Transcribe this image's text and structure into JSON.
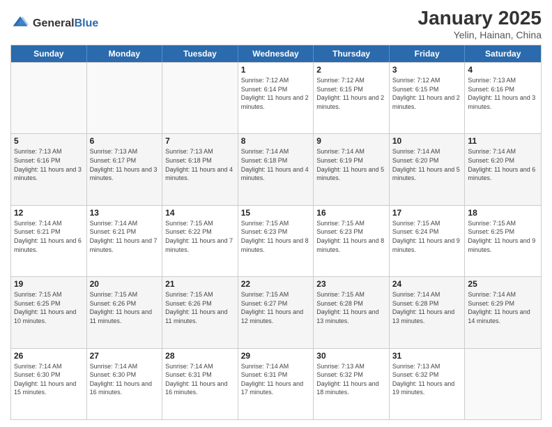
{
  "header": {
    "logo_general": "General",
    "logo_blue": "Blue",
    "title": "January 2025",
    "location": "Yelin, Hainan, China"
  },
  "weekdays": [
    "Sunday",
    "Monday",
    "Tuesday",
    "Wednesday",
    "Thursday",
    "Friday",
    "Saturday"
  ],
  "rows": [
    {
      "shade": false,
      "cells": [
        {
          "date": "",
          "info": ""
        },
        {
          "date": "",
          "info": ""
        },
        {
          "date": "",
          "info": ""
        },
        {
          "date": "1",
          "info": "Sunrise: 7:12 AM\nSunset: 6:14 PM\nDaylight: 11 hours and 2 minutes."
        },
        {
          "date": "2",
          "info": "Sunrise: 7:12 AM\nSunset: 6:15 PM\nDaylight: 11 hours and 2 minutes."
        },
        {
          "date": "3",
          "info": "Sunrise: 7:12 AM\nSunset: 6:15 PM\nDaylight: 11 hours and 2 minutes."
        },
        {
          "date": "4",
          "info": "Sunrise: 7:13 AM\nSunset: 6:16 PM\nDaylight: 11 hours and 3 minutes."
        }
      ]
    },
    {
      "shade": true,
      "cells": [
        {
          "date": "5",
          "info": "Sunrise: 7:13 AM\nSunset: 6:16 PM\nDaylight: 11 hours and 3 minutes."
        },
        {
          "date": "6",
          "info": "Sunrise: 7:13 AM\nSunset: 6:17 PM\nDaylight: 11 hours and 3 minutes."
        },
        {
          "date": "7",
          "info": "Sunrise: 7:13 AM\nSunset: 6:18 PM\nDaylight: 11 hours and 4 minutes."
        },
        {
          "date": "8",
          "info": "Sunrise: 7:14 AM\nSunset: 6:18 PM\nDaylight: 11 hours and 4 minutes."
        },
        {
          "date": "9",
          "info": "Sunrise: 7:14 AM\nSunset: 6:19 PM\nDaylight: 11 hours and 5 minutes."
        },
        {
          "date": "10",
          "info": "Sunrise: 7:14 AM\nSunset: 6:20 PM\nDaylight: 11 hours and 5 minutes."
        },
        {
          "date": "11",
          "info": "Sunrise: 7:14 AM\nSunset: 6:20 PM\nDaylight: 11 hours and 6 minutes."
        }
      ]
    },
    {
      "shade": false,
      "cells": [
        {
          "date": "12",
          "info": "Sunrise: 7:14 AM\nSunset: 6:21 PM\nDaylight: 11 hours and 6 minutes."
        },
        {
          "date": "13",
          "info": "Sunrise: 7:14 AM\nSunset: 6:21 PM\nDaylight: 11 hours and 7 minutes."
        },
        {
          "date": "14",
          "info": "Sunrise: 7:15 AM\nSunset: 6:22 PM\nDaylight: 11 hours and 7 minutes."
        },
        {
          "date": "15",
          "info": "Sunrise: 7:15 AM\nSunset: 6:23 PM\nDaylight: 11 hours and 8 minutes."
        },
        {
          "date": "16",
          "info": "Sunrise: 7:15 AM\nSunset: 6:23 PM\nDaylight: 11 hours and 8 minutes."
        },
        {
          "date": "17",
          "info": "Sunrise: 7:15 AM\nSunset: 6:24 PM\nDaylight: 11 hours and 9 minutes."
        },
        {
          "date": "18",
          "info": "Sunrise: 7:15 AM\nSunset: 6:25 PM\nDaylight: 11 hours and 9 minutes."
        }
      ]
    },
    {
      "shade": true,
      "cells": [
        {
          "date": "19",
          "info": "Sunrise: 7:15 AM\nSunset: 6:25 PM\nDaylight: 11 hours and 10 minutes."
        },
        {
          "date": "20",
          "info": "Sunrise: 7:15 AM\nSunset: 6:26 PM\nDaylight: 11 hours and 11 minutes."
        },
        {
          "date": "21",
          "info": "Sunrise: 7:15 AM\nSunset: 6:26 PM\nDaylight: 11 hours and 11 minutes."
        },
        {
          "date": "22",
          "info": "Sunrise: 7:15 AM\nSunset: 6:27 PM\nDaylight: 11 hours and 12 minutes."
        },
        {
          "date": "23",
          "info": "Sunrise: 7:15 AM\nSunset: 6:28 PM\nDaylight: 11 hours and 13 minutes."
        },
        {
          "date": "24",
          "info": "Sunrise: 7:14 AM\nSunset: 6:28 PM\nDaylight: 11 hours and 13 minutes."
        },
        {
          "date": "25",
          "info": "Sunrise: 7:14 AM\nSunset: 6:29 PM\nDaylight: 11 hours and 14 minutes."
        }
      ]
    },
    {
      "shade": false,
      "cells": [
        {
          "date": "26",
          "info": "Sunrise: 7:14 AM\nSunset: 6:30 PM\nDaylight: 11 hours and 15 minutes."
        },
        {
          "date": "27",
          "info": "Sunrise: 7:14 AM\nSunset: 6:30 PM\nDaylight: 11 hours and 16 minutes."
        },
        {
          "date": "28",
          "info": "Sunrise: 7:14 AM\nSunset: 6:31 PM\nDaylight: 11 hours and 16 minutes."
        },
        {
          "date": "29",
          "info": "Sunrise: 7:14 AM\nSunset: 6:31 PM\nDaylight: 11 hours and 17 minutes."
        },
        {
          "date": "30",
          "info": "Sunrise: 7:13 AM\nSunset: 6:32 PM\nDaylight: 11 hours and 18 minutes."
        },
        {
          "date": "31",
          "info": "Sunrise: 7:13 AM\nSunset: 6:32 PM\nDaylight: 11 hours and 19 minutes."
        },
        {
          "date": "",
          "info": ""
        }
      ]
    }
  ]
}
